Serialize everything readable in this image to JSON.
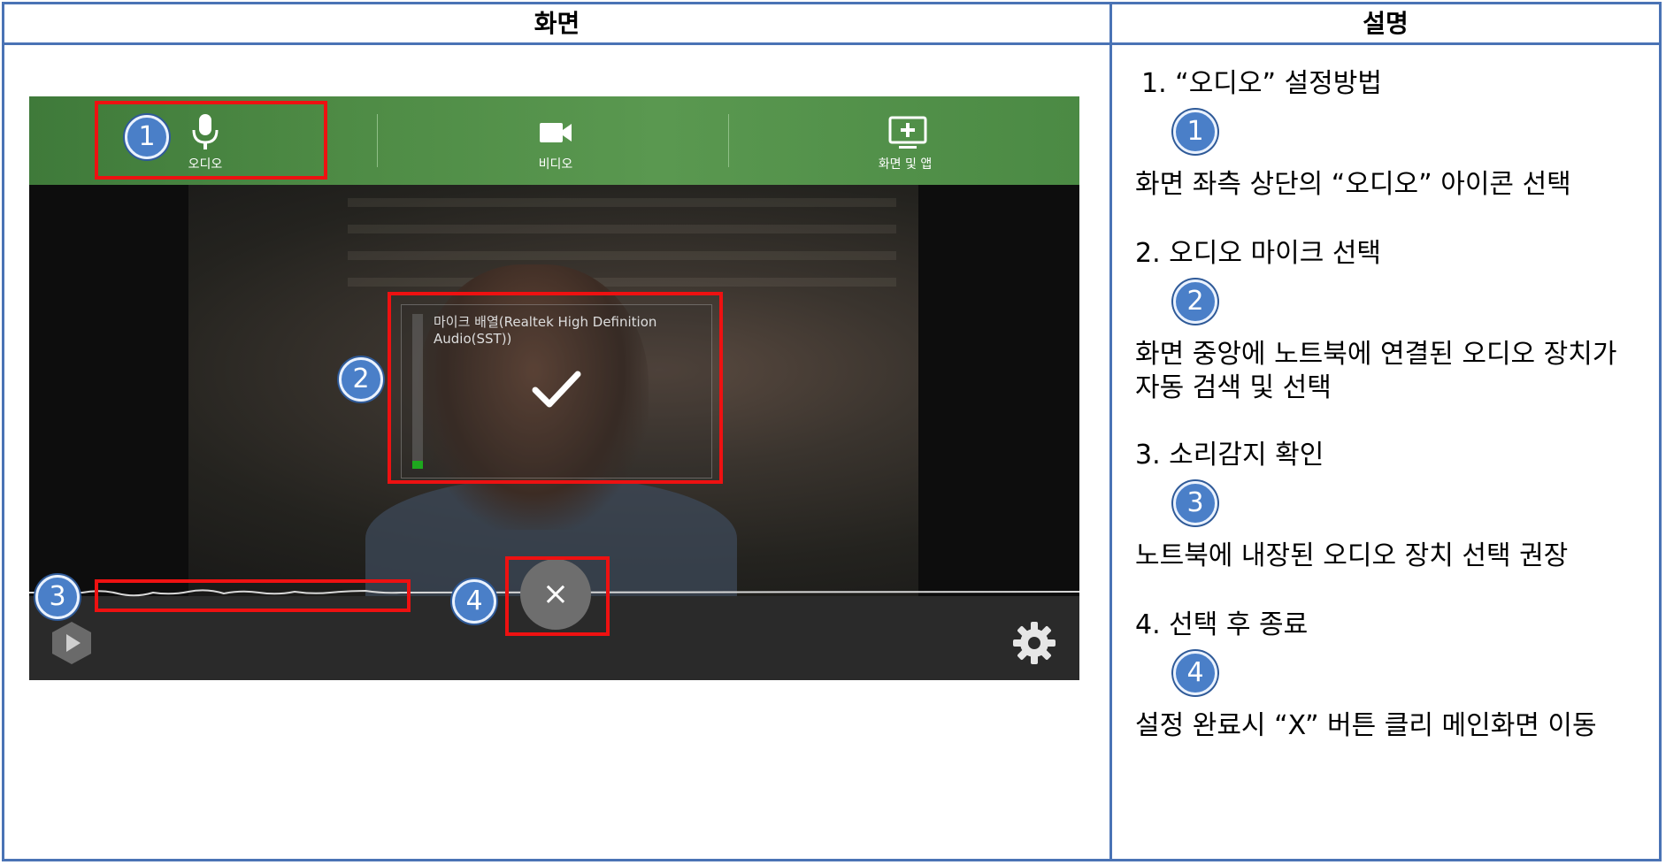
{
  "header": {
    "left_title": "화면",
    "right_title": "설명"
  },
  "screen": {
    "tabs": [
      {
        "label": "오디오",
        "icon": "microphone-icon"
      },
      {
        "label": "비디오",
        "icon": "video-camera-icon"
      },
      {
        "label": "화면 및 앱",
        "icon": "screen-share-icon"
      }
    ],
    "mic_device_name": "마이크 배열(Realtek High Definition Audio(SST))",
    "mic_level_fraction": 0.05,
    "close_button": "×",
    "accent_color": "#4e8b45",
    "highlight_color": "#ee1111"
  },
  "badges": [
    "1",
    "2",
    "3",
    "4"
  ],
  "descriptions": [
    {
      "title": "1. “오디오” 설정방법",
      "badge": "1",
      "text": "화면 좌측 상단의 “오디오” 아이콘 선택"
    },
    {
      "title": "2. 오디오 마이크 선택",
      "badge": "2",
      "text": "화면 중앙에 노트북에 연결된 오디오 장치가 자동 검색 및 선택"
    },
    {
      "title": "3. 소리감지 확인",
      "badge": "3",
      "text": "노트북에 내장된 오디오 장치 선택 권장"
    },
    {
      "title": "4. 선택 후 종료",
      "badge": "4",
      "text": "설정 완료시 “X” 버튼 클리 메인화면 이동"
    }
  ]
}
